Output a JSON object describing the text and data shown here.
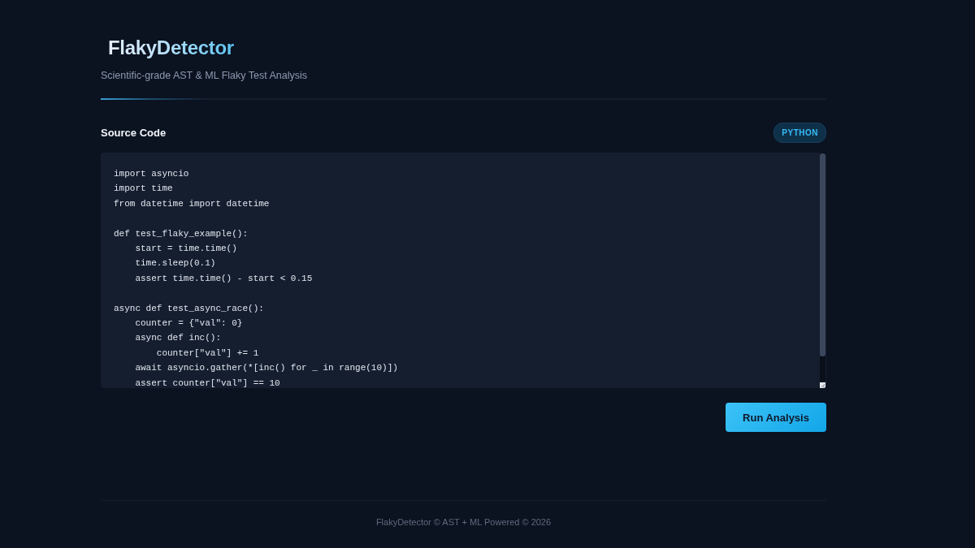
{
  "header": {
    "title": "FlakyDetector",
    "subtitle": "Scientific-grade AST & ML Flaky Test Analysis"
  },
  "editor": {
    "label": "Source Code",
    "language_badge": "PYTHON",
    "code": "import asyncio\nimport time\nfrom datetime import datetime\n\ndef test_flaky_example():\n    start = time.time()\n    time.sleep(0.1)\n    assert time.time() - start < 0.15\n\nasync def test_async_race():\n    counter = {\"val\": 0}\n    async def inc():\n        counter[\"val\"] += 1\n    await asyncio.gather(*[inc() for _ in range(10)])\n    assert counter[\"val\"] == 10"
  },
  "actions": {
    "run_button": "Run Analysis"
  },
  "footer": {
    "text": "FlakyDetector © AST + ML Powered © 2026"
  }
}
